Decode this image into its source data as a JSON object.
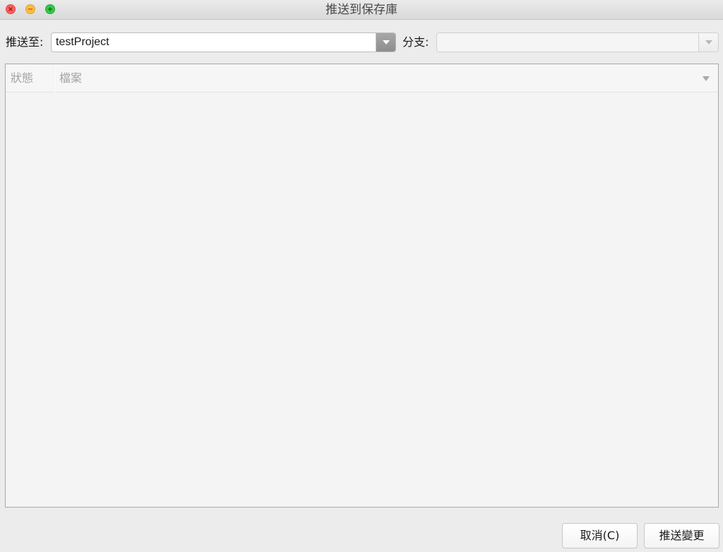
{
  "window": {
    "title": "推送到保存庫",
    "controls": {
      "close_icon": "close-icon",
      "minimize_icon": "minimize-icon",
      "maximize_icon": "maximize-icon"
    }
  },
  "push_to": {
    "label": "推送至:",
    "selected_value": "testProject",
    "arrow_icon": "chevron-down-icon"
  },
  "branch": {
    "label": "分支:",
    "selected_value": "",
    "arrow_icon": "chevron-down-icon",
    "enabled": false
  },
  "file_table": {
    "columns": [
      "狀態",
      "檔案"
    ],
    "sort_icon": "sort-down-icon",
    "rows": []
  },
  "buttons": {
    "cancel_label": "取消(C)",
    "push_label": "推送變更"
  },
  "colors": {
    "window_bg": "#ececec",
    "close": "#fc605c",
    "minimize": "#fdbc40",
    "maximize": "#34c84a"
  }
}
